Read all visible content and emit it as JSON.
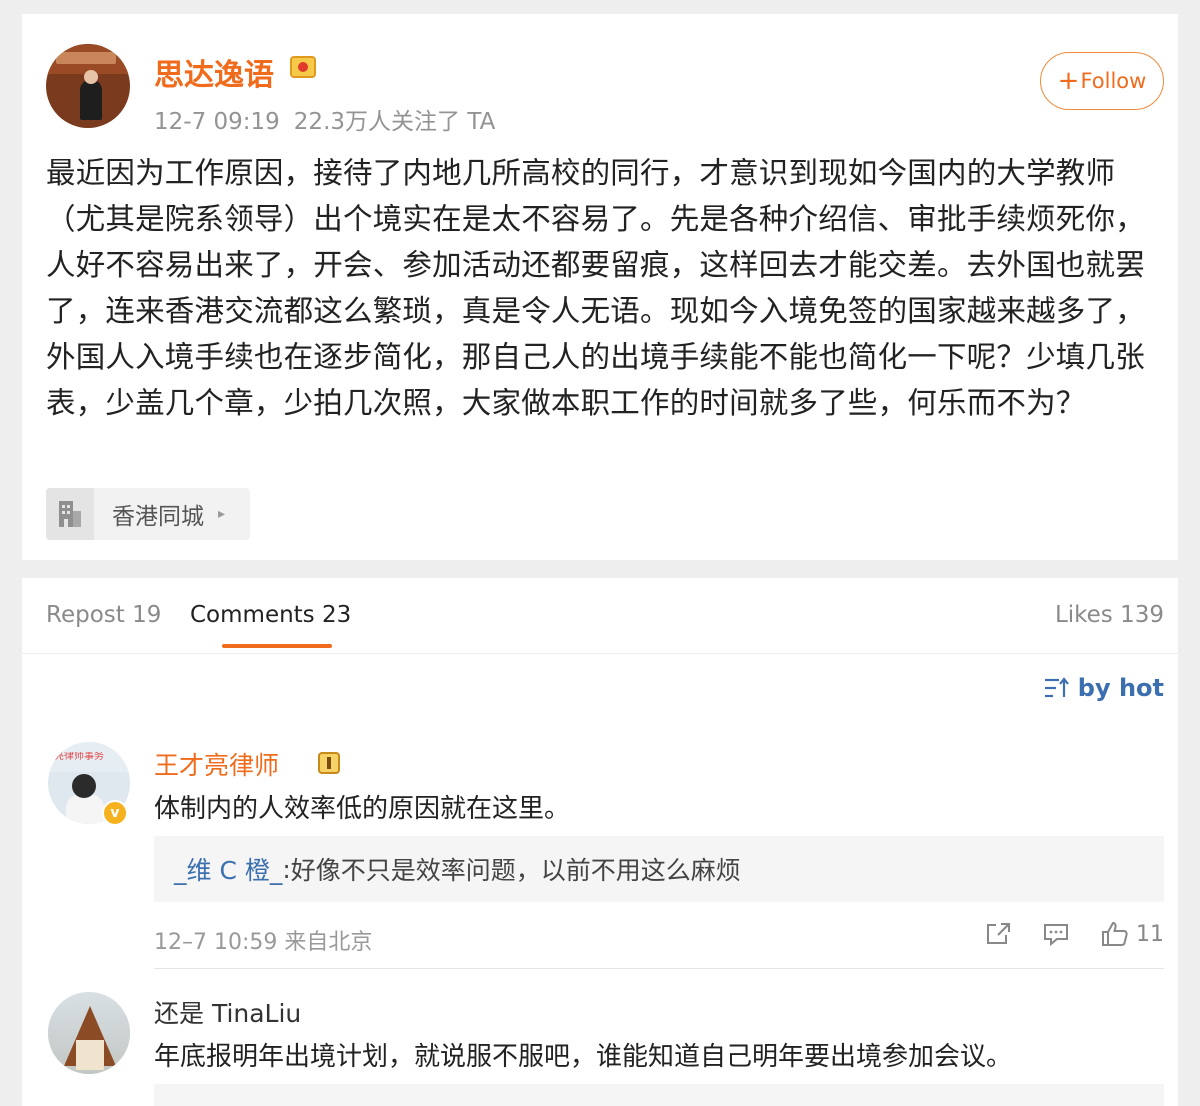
{
  "post": {
    "author": "思达逸语",
    "time": "12-7 09:19",
    "followers": "22.3万人关注了 TA",
    "follow_label": "Follow",
    "follow_plus": "+",
    "text": "最近因为工作原因，接待了内地几所高校的同行，才意识到现如今国内的大学教师（尤其是院系领导）出个境实在是太不容易了。先是各种介绍信、审批手续烦死你，人好不容易出来了，开会、参加活动还都要留痕，这样回去才能交差。去外国也就罢了，连来香港交流都这么繁琐，真是令人无语。现如今入境免签的国家越来越多了，外国人入境手续也在逐步简化，那自己人的出境手续能不能也简化一下呢？少填几张表，少盖几个章，少拍几次照，大家做本职工作的时间就多了些，何乐而不为？",
    "location": "香港同城",
    "icons": {
      "badge": "crown-icon",
      "location": "building-icon",
      "chevron": "chevron-right-icon"
    }
  },
  "tabs": {
    "repost": "Repost 19",
    "comments": "Comments 23",
    "likes": "Likes 139"
  },
  "sort": {
    "label": "by hot",
    "icon": "sort-icon"
  },
  "comments": [
    {
      "name": "王才亮律师",
      "text": "体制内的人效率低的原因就在这里。",
      "reply_user": "_维 C 橙_",
      "reply_sep": ":",
      "reply_text": " 好像不只是效率问题，以前不用这么麻烦",
      "meta": "12–7 10:59 来自北京",
      "likes": "11",
      "avatar_text": "亮律师事务",
      "verified_mark": "v"
    },
    {
      "name": "还是 TinaLiu",
      "text": "年底报明年出境计划，就说服不服吧，谁能知道自己明年要出境参加会议。"
    }
  ],
  "colors": {
    "accent": "#f06b1c",
    "link": "#3b6fb0",
    "muted": "#999999"
  }
}
